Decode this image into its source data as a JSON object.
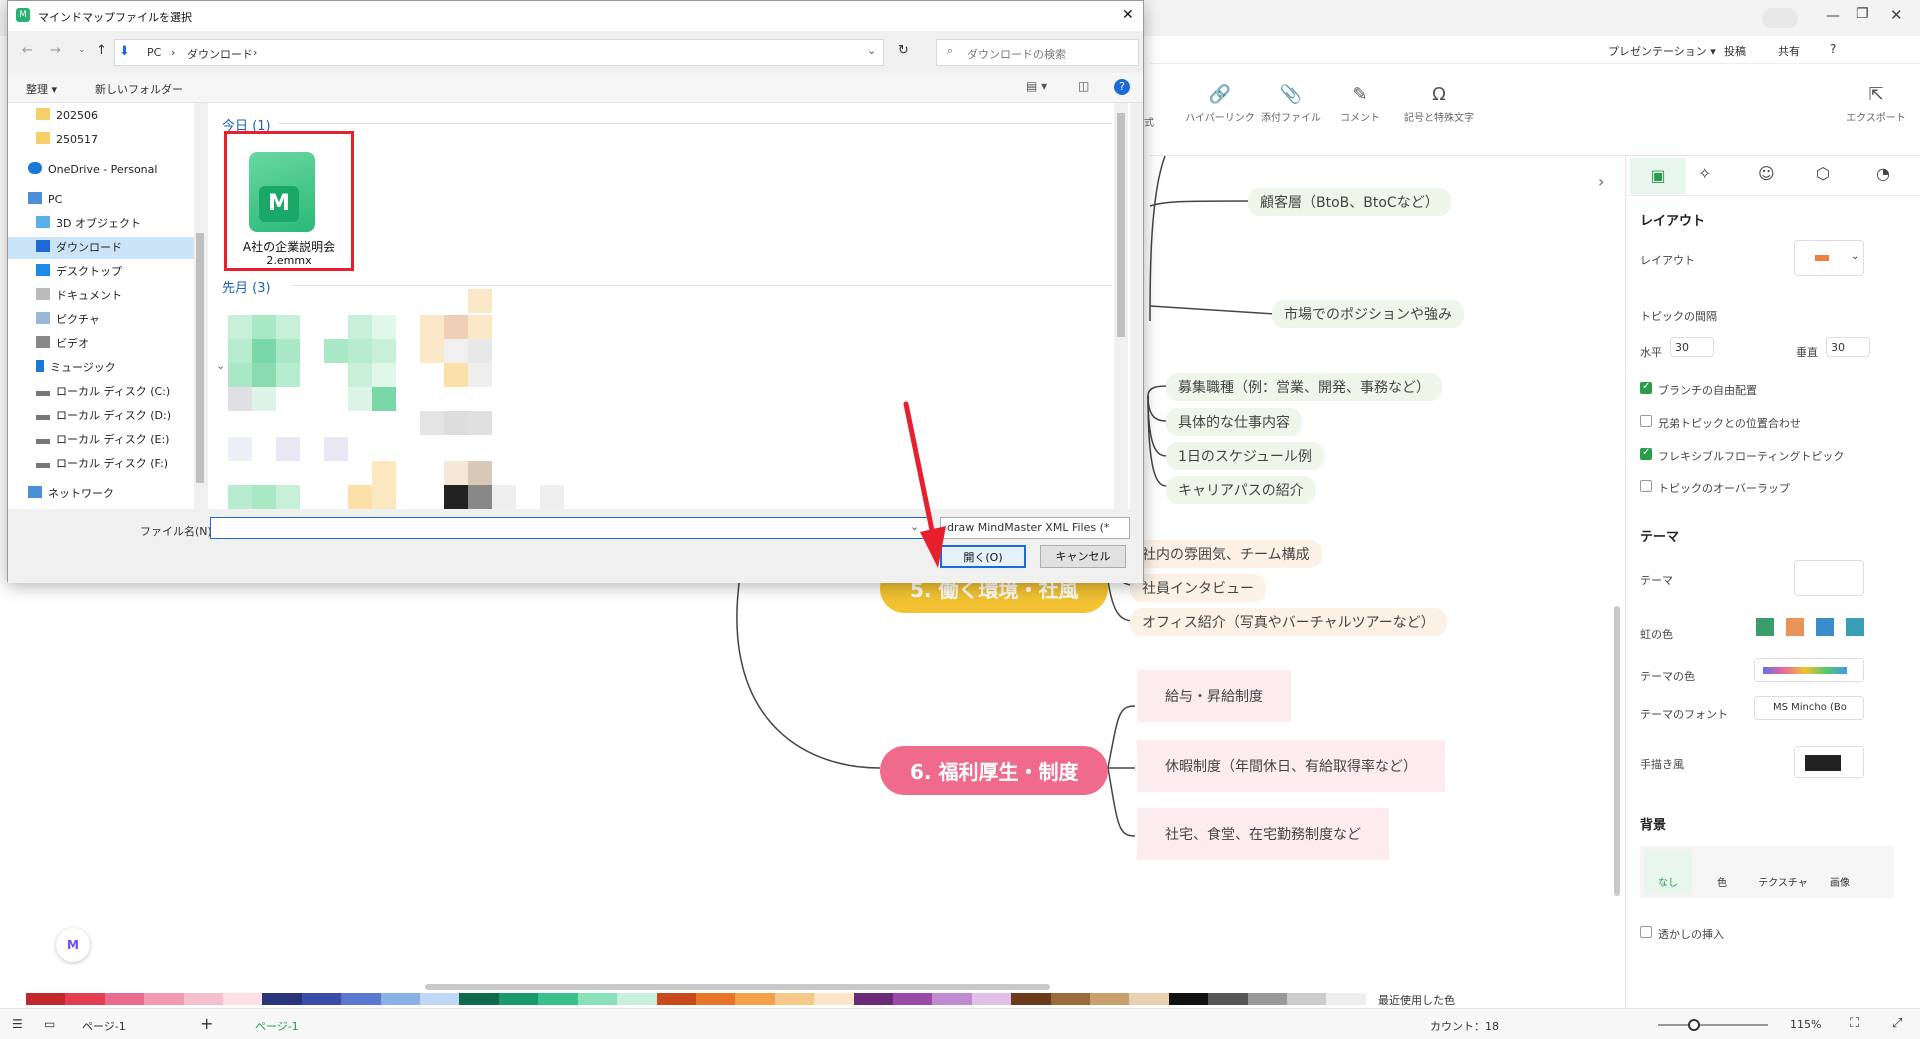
{
  "dialog": {
    "title": "マインドマップファイルを選択",
    "address": {
      "pc": "PC",
      "folder": "ダウンロード"
    },
    "search_placeholder": "ダウンロードの検索",
    "toolbar": {
      "organize": "整理 ▾",
      "new_folder": "新しいフォルダー"
    },
    "nav": [
      {
        "label": "202506",
        "icon": "folder-icon"
      },
      {
        "label": "250517",
        "icon": "folder-icon"
      },
      {
        "label": "OneDrive - Personal",
        "icon": "cloud-icon"
      },
      {
        "label": "PC",
        "icon": "pc-icon"
      },
      {
        "label": "3D オブジェクト",
        "icon": "3d-icon"
      },
      {
        "label": "ダウンロード",
        "icon": "download-icon"
      },
      {
        "label": "デスクトップ",
        "icon": "desktop-icon"
      },
      {
        "label": "ドキュメント",
        "icon": "document-icon"
      },
      {
        "label": "ピクチャ",
        "icon": "picture-icon"
      },
      {
        "label": "ビデオ",
        "icon": "video-icon"
      },
      {
        "label": "ミュージック",
        "icon": "music-icon"
      },
      {
        "label": "ローカル ディスク (C:)",
        "icon": "drive-icon"
      },
      {
        "label": "ローカル ディスク (D:)",
        "icon": "drive-icon"
      },
      {
        "label": "ローカル ディスク (E:)",
        "icon": "drive-icon"
      },
      {
        "label": "ローカル ディスク (F:)",
        "icon": "drive-icon"
      },
      {
        "label": "ネットワーク",
        "icon": "network-icon"
      }
    ],
    "groups": {
      "today": "今日 (1)",
      "last_month": "先月 (3)"
    },
    "file": {
      "name": "A社の企業説明会",
      "ext": "2.emmx"
    },
    "filename_label": "ファイル名(N):",
    "filename_value": "",
    "filetype": "draw MindMaster XML Files (*",
    "open_button": "開く(O)",
    "cancel_button": "キャンセル"
  },
  "app": {
    "top_actions": [
      "プレゼンテーション ▾",
      "投稿",
      "共有",
      "?"
    ],
    "ribbon": [
      "ハイパーリンク",
      "添付ファイル",
      "コメント",
      "記号と特殊文字",
      "エクスポート"
    ],
    "ribbon_partial": "式",
    "nodes_green": [
      "顧客層（BtoB、BtoCなど）",
      "市場でのポジションや強み",
      "募集職種（例：営業、開発、事務など）",
      "具体的な仕事内容",
      "1日のスケジュール例",
      "キャリアパスの紹介"
    ],
    "nodes_peach": [
      "社内の雰囲気、チーム構成",
      "社員インタビュー",
      "オフィス紹介（写真やバーチャルツアーなど）"
    ],
    "nodes_pink": [
      "給与・昇給制度",
      "休暇制度（年間休日、有給取得率など）",
      "社宅、食堂、在宅勤務制度など"
    ],
    "main5": "5. 働く環境・社風",
    "main6": "6. 福利厚生・制度",
    "colors": {
      "main5": "#f2c232",
      "main6": "#f06a8c",
      "accent": "#2a9d4a"
    }
  },
  "panel": {
    "layout_title": "レイアウト",
    "layout_label": "レイアウト",
    "spacing_label": "トピックの間隔",
    "horizontal_label": "水平",
    "horizontal_value": "30",
    "vertical_label": "垂直",
    "vertical_value": "30",
    "checks": [
      {
        "label": "ブランチの自由配置",
        "checked": true
      },
      {
        "label": "兄弟トピックとの位置合わせ",
        "checked": false
      },
      {
        "label": "フレキシブルフローティングトピック",
        "checked": true
      },
      {
        "label": "トピックのオーバーラップ",
        "checked": false
      }
    ],
    "theme_title": "テーマ",
    "theme_label": "テーマ",
    "rainbow_label": "虹の色",
    "theme_color_label": "テーマの色",
    "theme_font_label": "テーマのフォント",
    "theme_font_value": "MS Mincho (Bo",
    "handdrawn_label": "手描き風",
    "bg_title": "背景",
    "bg_options": [
      "なし",
      "色",
      "テクスチャ",
      "画像"
    ],
    "watermark_label": "透かしの挿入"
  },
  "palette_recent": "最近使用した色",
  "status": {
    "page": "ページ-1",
    "page_tab": "ページ-1",
    "count": "カウント：18",
    "zoom": "115%"
  }
}
